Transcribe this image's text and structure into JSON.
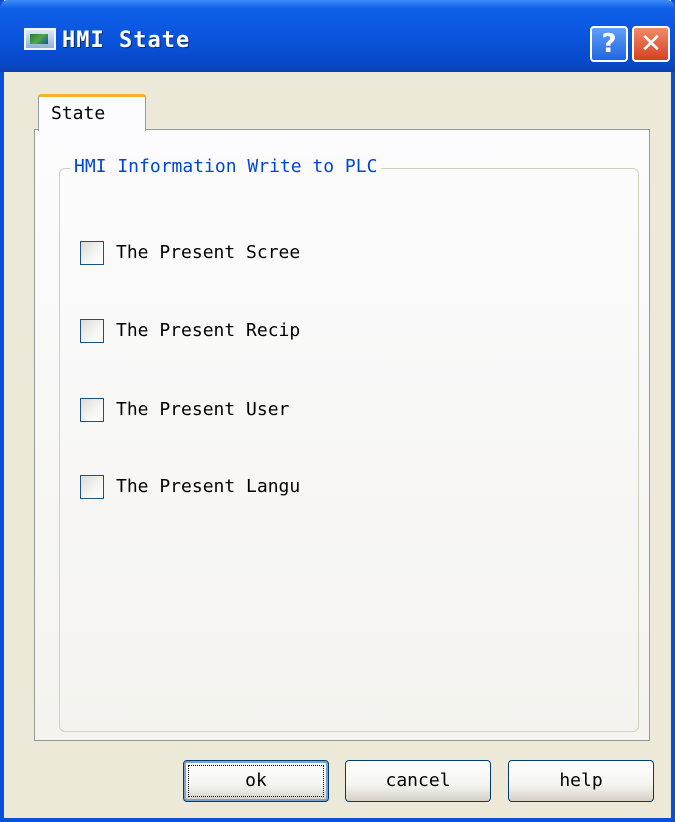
{
  "window": {
    "title": "HMI State"
  },
  "titlebar": {
    "help_glyph": "?",
    "close_glyph": "✕"
  },
  "tabs": [
    {
      "label": "State",
      "selected": true
    }
  ],
  "group": {
    "caption": "HMI Information Write to PLC",
    "items": [
      {
        "label": "The Present Scree",
        "checked": false
      },
      {
        "label": "The Present Recip",
        "checked": false
      },
      {
        "label": "The Present User",
        "checked": false
      },
      {
        "label": "The Present Langu",
        "checked": false
      }
    ]
  },
  "buttons": {
    "ok": "ok",
    "cancel": "cancel",
    "help": "help"
  },
  "colors": {
    "titlebar": "#0a55de",
    "window_bg": "#ece9d8",
    "group_caption": "#0046d5",
    "tab_highlight": "#f8b230",
    "close_button": "#d6411f"
  },
  "icons": [
    "app-window-icon",
    "help-icon",
    "close-icon"
  ]
}
